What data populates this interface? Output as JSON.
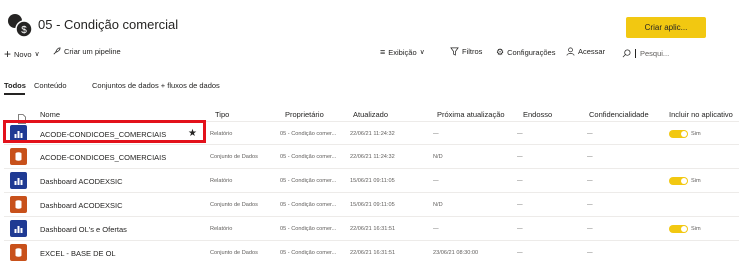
{
  "workspace": {
    "title": "05 - Condição comercial",
    "create_label": "Criar aplic..."
  },
  "toolbar": {
    "new_label": "Novo",
    "pipeline_label": "Criar um pipeline",
    "view_label": "Exibição",
    "filters_label": "Filtros",
    "settings_label": "Configurações",
    "access_label": "Acessar",
    "search_placeholder": "Pesqui..."
  },
  "tabs": [
    "Todos",
    "Conteúdo",
    "Conjuntos de dados + fluxos de dados"
  ],
  "columns": {
    "name": "Nome",
    "type": "Tipo",
    "owner": "Proprietário",
    "updated": "Atualizado",
    "next_update": "Próxima atualização",
    "endorsement": "Endosso",
    "sensitivity": "Confidencialidade",
    "include_app": "Incluir no aplicativo"
  },
  "rows": [
    {
      "icon": "report-icon",
      "name": "ACODE-CONDICOES_COMERCIAIS",
      "type": "Relatório",
      "owner": "05 - Condição comer...",
      "updated": "22/06/21 11:24:32",
      "next_update": "—",
      "endorsement": "—",
      "sensitivity": "—",
      "include": "Sim",
      "starred": true
    },
    {
      "icon": "dataset-icon",
      "name": "ACODE-CONDICOES_COMERCIAIS",
      "type": "Conjunto de Dados",
      "owner": "05 - Condição comer...",
      "updated": "22/06/21 11:24:32",
      "next_update": "N/D",
      "endorsement": "—",
      "sensitivity": "—",
      "include": ""
    },
    {
      "icon": "report-icon",
      "name": "Dashboard ACODEXSIC",
      "type": "Relatório",
      "owner": "05 - Condição comer...",
      "updated": "15/06/21 09:11:05",
      "next_update": "—",
      "endorsement": "—",
      "sensitivity": "—",
      "include": "Sim"
    },
    {
      "icon": "dataset-icon",
      "name": "Dashboard ACODEXSIC",
      "type": "Conjunto de Dados",
      "owner": "05 - Condição comer...",
      "updated": "15/06/21 09:11:05",
      "next_update": "N/D",
      "endorsement": "—",
      "sensitivity": "—",
      "include": ""
    },
    {
      "icon": "report-icon",
      "name": "Dashboard OL's e Ofertas",
      "type": "Relatório",
      "owner": "05 - Condição comer...",
      "updated": "22/06/21 16:31:51",
      "next_update": "—",
      "endorsement": "—",
      "sensitivity": "—",
      "include": "Sim"
    },
    {
      "icon": "dataset-icon",
      "name": "EXCEL - BASE DE OL",
      "type": "Conjunto de Dados",
      "owner": "05 - Condição comer...",
      "updated": "22/06/21 16:31:51",
      "next_update": "23/06/21 08:30:00",
      "endorsement": "—",
      "sensitivity": "—",
      "include": ""
    }
  ],
  "colors": {
    "accent": "#f2c811",
    "report": "#1f3a93",
    "dataset": "#c8511b",
    "highlight": "#e3111b"
  }
}
